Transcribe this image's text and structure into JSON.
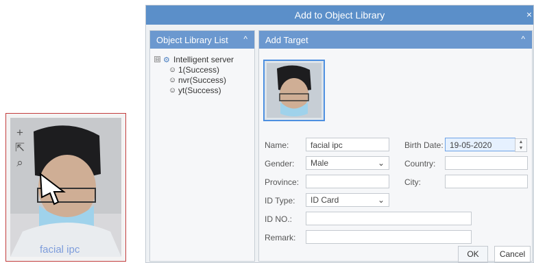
{
  "preview": {
    "tools": [
      {
        "name": "plus-icon",
        "glyph": "+"
      },
      {
        "name": "export-icon",
        "glyph": "⇱"
      },
      {
        "name": "search-icon",
        "glyph": "⌕"
      }
    ],
    "caption": "facial ipc"
  },
  "dialog": {
    "title": "Add to Object Library",
    "close": "×"
  },
  "left_panel": {
    "title": "Object Library List",
    "collapse": "^",
    "tree": {
      "root": {
        "label": "Intelligent server",
        "expand": "⊟"
      },
      "items": [
        {
          "label": "1(Success)"
        },
        {
          "label": "nvr(Success)"
        },
        {
          "label": "yt(Success)"
        }
      ]
    }
  },
  "right_panel": {
    "title": "Add Target",
    "collapse": "^",
    "form": {
      "name_label": "Name:",
      "name_value": "facial ipc",
      "birth_label": "Birth Date:",
      "birth_value": "19-05-2020",
      "gender_label": "Gender:",
      "gender_value": "Male",
      "country_label": "Country:",
      "province_label": "Province:",
      "city_label": "City:",
      "id_type_label": "ID Type:",
      "id_type_value": "ID Card",
      "id_no_label": "ID NO.:",
      "remark_label": "Remark:"
    },
    "buttons": {
      "ok": "OK",
      "cancel": "Cancel"
    }
  },
  "colors": {
    "titlebar": "#5b8fc9",
    "panel_header": "#6b98cf",
    "thumbnail_border": "#c23b3b",
    "photo_border": "#4d8fe0"
  }
}
